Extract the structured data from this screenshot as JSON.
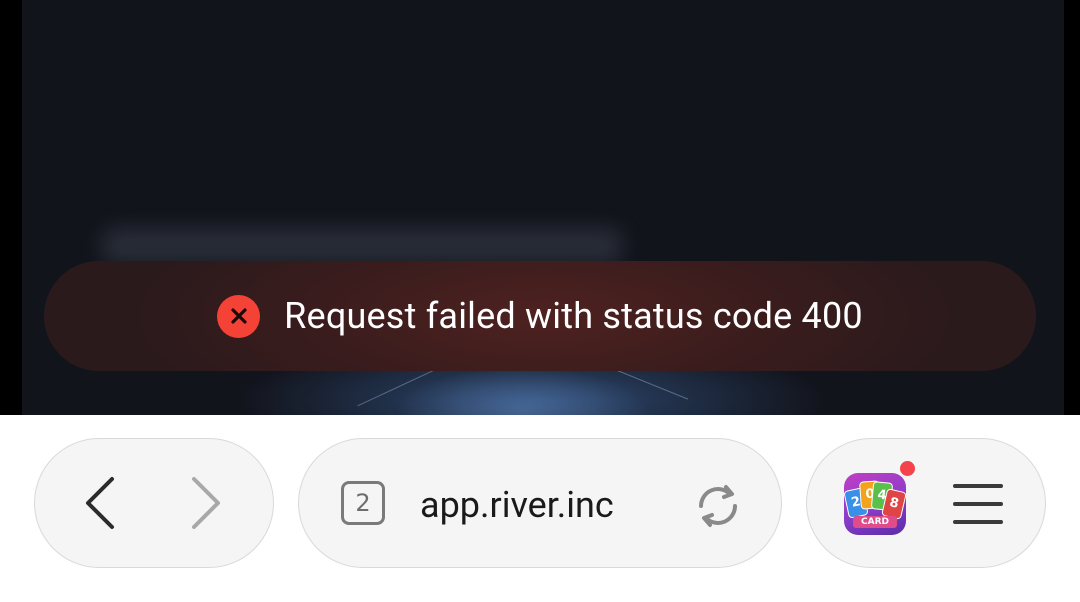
{
  "toast": {
    "message": "Request failed with status code 400",
    "icon": "error-icon",
    "icon_color": "#f44336"
  },
  "browser": {
    "back_icon": "chevron-left-icon",
    "forward_icon": "chevron-right-icon",
    "tabs_count": "2",
    "url": "app.river.inc",
    "reload_icon": "reload-icon",
    "extension": {
      "icon": "2048-card-app-icon",
      "card_digits": [
        "2",
        "0",
        "4",
        "8"
      ],
      "label": "CARD",
      "has_notification": true,
      "notification_color": "#f4434b"
    },
    "menu_icon": "hamburger-menu-icon"
  },
  "page": {
    "background_color": "#12141c"
  }
}
